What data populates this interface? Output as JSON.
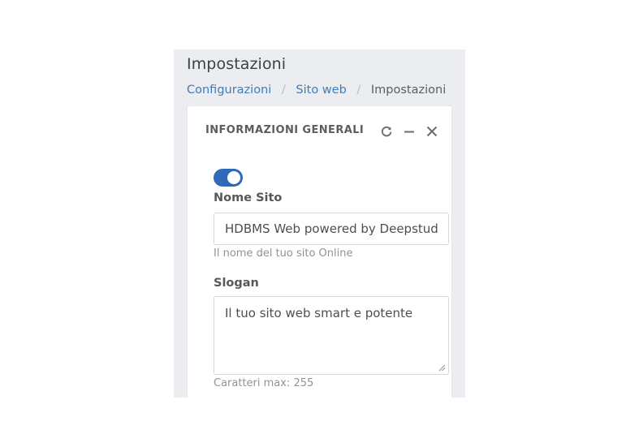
{
  "page": {
    "title": "Impostazioni"
  },
  "breadcrumb": {
    "items": [
      {
        "label": "Configurazioni"
      },
      {
        "label": "Sito web"
      },
      {
        "label": "Impostazioni"
      }
    ],
    "separator": "/"
  },
  "card": {
    "title": "INFORMAZIONI GENERALI",
    "tools": {
      "refresh_icon": "refresh-icon",
      "minimize_icon": "minimize-icon",
      "close_icon": "close-icon"
    }
  },
  "form": {
    "enabled_toggle": {
      "state": "on",
      "color": "#3069b8"
    },
    "site_name": {
      "label": "Nome Sito",
      "value": "HDBMS Web powered by Deepstudio",
      "help": "Il nome del tuo sito Online"
    },
    "slogan": {
      "label": "Slogan",
      "value": "Il tuo sito web smart e potente",
      "help": "Caratteri max: 255"
    }
  },
  "colors": {
    "link": "#3f7dba",
    "panel_bg": "#ebedf0",
    "toggle_on": "#3069b8"
  }
}
